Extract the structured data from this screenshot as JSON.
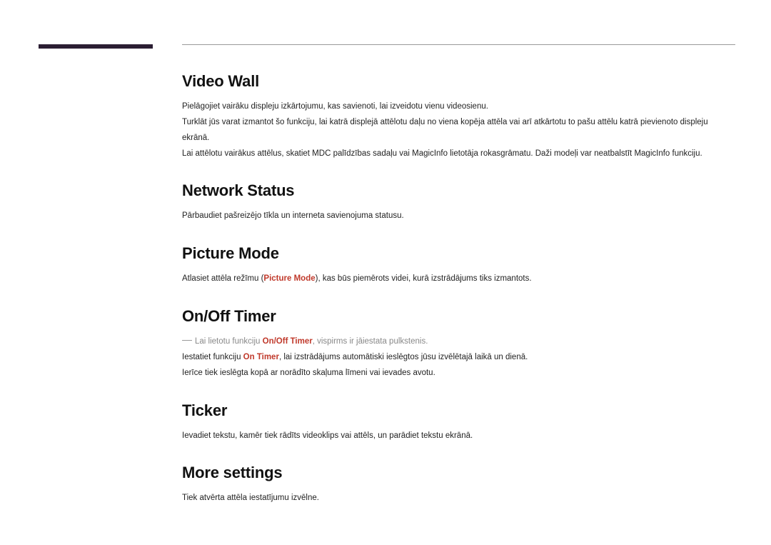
{
  "sections": {
    "videoWall": {
      "heading": "Video Wall",
      "p1": "Pielāgojiet vairāku displeju izkārtojumu, kas savienoti, lai izveidotu vienu videosienu.",
      "p2": "Turklāt jūs varat izmantot šo funkciju, lai katrā displejā attēlotu daļu no viena kopēja attēla vai arī atkārtotu to pašu attēlu katrā pievienoto displeju ekrānā.",
      "p3": "Lai attēlotu vairākus attēlus, skatiet MDC palīdzības sadaļu vai MagicInfo lietotāja rokasgrāmatu. Daži modeļi var neatbalstīt MagicInfo funkciju."
    },
    "networkStatus": {
      "heading": "Network Status",
      "p1": "Pārbaudiet pašreizējo tīkla un interneta savienojuma statusu."
    },
    "pictureMode": {
      "heading": "Picture Mode",
      "p1_pre": "Atlasiet attēla režīmu (",
      "p1_hl": "Picture Mode",
      "p1_post": "), kas būs piemērots videi, kurā izstrādājums tiks izmantots."
    },
    "onOffTimer": {
      "heading": "On/Off Timer",
      "note_pre": "Lai lietotu funkciju ",
      "note_hl": "On/Off Timer",
      "note_post": ", vispirms ir jāiestata pulkstenis.",
      "p2_pre": "Iestatiet funkciju ",
      "p2_hl": "On Timer",
      "p2_post": ", lai izstrādājums automātiski ieslēgtos jūsu izvēlētajā laikā un dienā.",
      "p3": "Ierīce tiek ieslēgta kopā ar norādīto skaļuma līmeni vai ievades avotu."
    },
    "ticker": {
      "heading": "Ticker",
      "p1": "Ievadiet tekstu, kamēr tiek rādīts videoklips vai attēls, un parādiet tekstu ekrānā."
    },
    "moreSettings": {
      "heading": "More settings",
      "p1": "Tiek atvērta attēla iestatījumu izvēlne."
    }
  }
}
